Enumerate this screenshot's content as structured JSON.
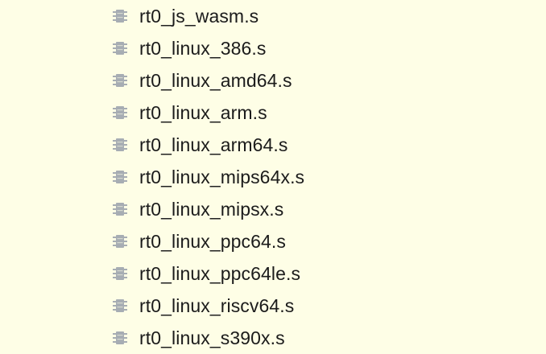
{
  "file_list": {
    "items": [
      {
        "name": "rt0_js_wasm.s",
        "icon": "file-icon"
      },
      {
        "name": "rt0_linux_386.s",
        "icon": "file-icon"
      },
      {
        "name": "rt0_linux_amd64.s",
        "icon": "file-icon"
      },
      {
        "name": "rt0_linux_arm.s",
        "icon": "file-icon"
      },
      {
        "name": "rt0_linux_arm64.s",
        "icon": "file-icon"
      },
      {
        "name": "rt0_linux_mips64x.s",
        "icon": "file-icon"
      },
      {
        "name": "rt0_linux_mipsx.s",
        "icon": "file-icon"
      },
      {
        "name": "rt0_linux_ppc64.s",
        "icon": "file-icon"
      },
      {
        "name": "rt0_linux_ppc64le.s",
        "icon": "file-icon"
      },
      {
        "name": "rt0_linux_riscv64.s",
        "icon": "file-icon"
      },
      {
        "name": "rt0_linux_s390x.s",
        "icon": "file-icon"
      }
    ]
  },
  "colors": {
    "background": "#fefee6",
    "text": "#1b1b1b",
    "icon": "#a7adb3"
  }
}
